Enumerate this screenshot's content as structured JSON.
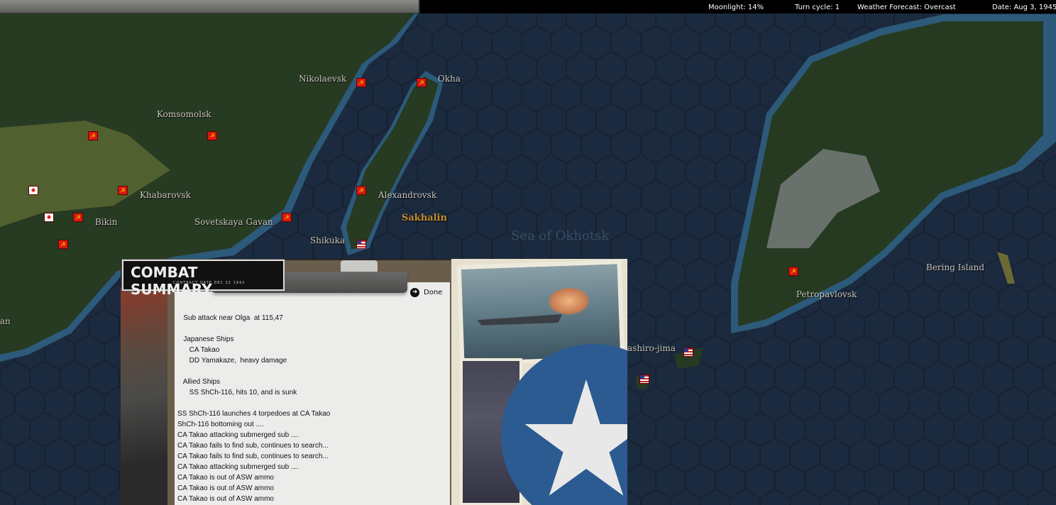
{
  "status_bar": {
    "moonlight": "Moonlight: 14%",
    "turn_cycle": "Turn cycle: 1",
    "weather": "Weather Forecast: Overcast",
    "date": "Date: Aug 3, 1945"
  },
  "map": {
    "labels": {
      "nikolaevsk": "Nikolaevsk",
      "okha": "Okha",
      "komsomolsk": "Komsomolsk",
      "khabarovsk": "Khabarovsk",
      "alexandrovsk": "Alexandrovsk",
      "bikin": "Bikin",
      "sovetskaya_gavan": "Sovetskaya Gavan",
      "sakhalin": "Sakhalin",
      "shikuka": "Shikuka",
      "sea": "Sea of Okhotsk",
      "petropavlovsk": "Petropavlovsk",
      "bering_island": "Bering Island",
      "paramushiro": "ashiro-jima",
      "partial_left": "an"
    },
    "colors": {
      "sea": "#1b2a3e",
      "coast": "#2d5a7a",
      "land": "#2a3a22",
      "soviet": "#d81a10"
    }
  },
  "combat_summary": {
    "title": "COMBAT SUMMARY",
    "subtitle": "CONTRACT DATE DEC 31 1942",
    "done_label": "Done",
    "log": [
      "   Sub attack near Olga  at 115,47",
      "",
      "   Japanese Ships",
      "      CA Takao",
      "      DD Yamakaze,  heavy damage",
      "",
      "   Allied Ships",
      "      SS ShCh-116, hits 10, and is sunk",
      "",
      "SS ShCh-116 launches 4 torpedoes at CA Takao",
      "ShCh-116 bottoming out ....",
      "CA Takao attacking submerged sub ....",
      "CA Takao fails to find sub, continues to search...",
      "CA Takao fails to find sub, continues to search...",
      "CA Takao attacking submerged sub ....",
      "CA Takao is out of ASW ammo",
      "CA Takao is out of ASW ammo",
      "CA Takao is out of ASW ammo"
    ]
  }
}
